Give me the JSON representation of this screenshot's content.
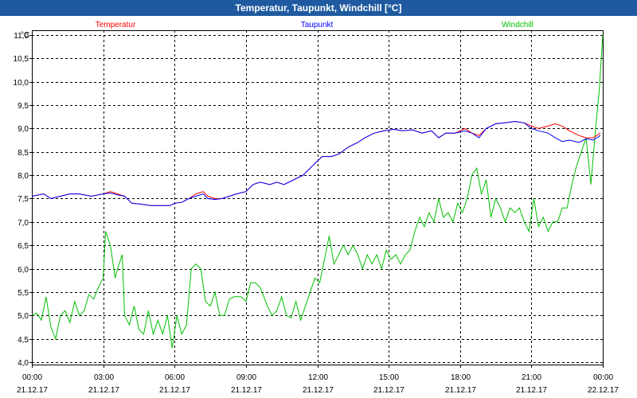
{
  "window": {
    "title": "Temperatur, Taupunkt, Windchill [°C]"
  },
  "colors": {
    "titlebar": "#1f5aa0",
    "temperatur": "#ff0000",
    "taupunkt": "#0000ff",
    "windchill": "#00c000",
    "grid": "#000000"
  },
  "chart_data": {
    "type": "line",
    "title": "Temperatur, Taupunkt, Windchill [°C]",
    "ylabel": "°C",
    "ylim": [
      3.95,
      11.1
    ],
    "yticks": [
      "4,0",
      "4,5",
      "5,0",
      "5,5",
      "6,0",
      "6,5",
      "7,0",
      "7,5",
      "8,0",
      "8,5",
      "9,0",
      "9,5",
      "10,0",
      "10,5",
      "11,0"
    ],
    "ytick_values": [
      4.0,
      4.5,
      5.0,
      5.5,
      6.0,
      6.5,
      7.0,
      7.5,
      8.0,
      8.5,
      9.0,
      9.5,
      10.0,
      10.5,
      11.0
    ],
    "xlim": [
      0,
      24
    ],
    "xticks": [
      {
        "time": "00:00",
        "date": "21.12.17",
        "hour": 0
      },
      {
        "time": "03:00",
        "date": "21.12.17",
        "hour": 3
      },
      {
        "time": "06:00",
        "date": "21.12.17",
        "hour": 6
      },
      {
        "time": "09:00",
        "date": "21.12.17",
        "hour": 9
      },
      {
        "time": "12:00",
        "date": "21.12.17",
        "hour": 12
      },
      {
        "time": "15:00",
        "date": "21.12.17",
        "hour": 15
      },
      {
        "time": "18:00",
        "date": "21.12.17",
        "hour": 18
      },
      {
        "time": "21:00",
        "date": "21.12.17",
        "hour": 21
      },
      {
        "time": "00:00",
        "date": "22.12.17",
        "hour": 24
      }
    ],
    "grid": true,
    "legend_placement": "top",
    "series": [
      {
        "name": "Temperatur",
        "color": "#ff0000",
        "points": [
          [
            0,
            7.55
          ],
          [
            0.5,
            7.6
          ],
          [
            0.8,
            7.5
          ],
          [
            1.2,
            7.55
          ],
          [
            1.6,
            7.6
          ],
          [
            2.0,
            7.6
          ],
          [
            2.5,
            7.55
          ],
          [
            3.0,
            7.6
          ],
          [
            3.3,
            7.65
          ],
          [
            3.6,
            7.6
          ],
          [
            3.9,
            7.55
          ],
          [
            4.2,
            7.4
          ],
          [
            4.6,
            7.38
          ],
          [
            5.0,
            7.35
          ],
          [
            5.4,
            7.35
          ],
          [
            5.8,
            7.35
          ],
          [
            6.0,
            7.4
          ],
          [
            6.3,
            7.42
          ],
          [
            6.6,
            7.5
          ],
          [
            6.9,
            7.6
          ],
          [
            7.2,
            7.65
          ],
          [
            7.4,
            7.55
          ],
          [
            7.7,
            7.5
          ],
          [
            8.0,
            7.5
          ],
          [
            8.3,
            7.55
          ],
          [
            8.6,
            7.6
          ],
          [
            9.0,
            7.65
          ],
          [
            9.3,
            7.8
          ],
          [
            9.6,
            7.85
          ],
          [
            10.0,
            7.8
          ],
          [
            10.3,
            7.85
          ],
          [
            10.6,
            7.8
          ],
          [
            11.0,
            7.9
          ],
          [
            11.4,
            8.0
          ],
          [
            11.8,
            8.2
          ],
          [
            12.2,
            8.4
          ],
          [
            12.6,
            8.4
          ],
          [
            12.9,
            8.45
          ],
          [
            13.3,
            8.6
          ],
          [
            13.7,
            8.7
          ],
          [
            14.0,
            8.8
          ],
          [
            14.4,
            8.9
          ],
          [
            14.8,
            8.95
          ],
          [
            15.2,
            8.98
          ],
          [
            15.6,
            8.95
          ],
          [
            16.0,
            8.97
          ],
          [
            16.4,
            8.9
          ],
          [
            16.8,
            8.95
          ],
          [
            17.1,
            8.8
          ],
          [
            17.4,
            8.9
          ],
          [
            17.8,
            8.9
          ],
          [
            18.2,
            9.0
          ],
          [
            18.5,
            8.9
          ],
          [
            18.8,
            8.85
          ],
          [
            19.1,
            9.0
          ],
          [
            19.5,
            9.1
          ],
          [
            19.9,
            9.12
          ],
          [
            20.3,
            9.15
          ],
          [
            20.7,
            9.12
          ],
          [
            21.0,
            9.05
          ],
          [
            21.3,
            9.0
          ],
          [
            21.7,
            9.05
          ],
          [
            22.0,
            9.1
          ],
          [
            22.3,
            9.05
          ],
          [
            22.6,
            8.95
          ],
          [
            23.0,
            8.85
          ],
          [
            23.3,
            8.8
          ],
          [
            23.6,
            8.8
          ],
          [
            23.9,
            8.9
          ]
        ]
      },
      {
        "name": "Taupunkt",
        "color": "#0000ff",
        "points": [
          [
            0,
            7.55
          ],
          [
            0.5,
            7.6
          ],
          [
            0.8,
            7.5
          ],
          [
            1.2,
            7.55
          ],
          [
            1.6,
            7.6
          ],
          [
            2.0,
            7.6
          ],
          [
            2.5,
            7.55
          ],
          [
            3.0,
            7.6
          ],
          [
            3.3,
            7.62
          ],
          [
            3.6,
            7.58
          ],
          [
            3.9,
            7.55
          ],
          [
            4.2,
            7.4
          ],
          [
            4.6,
            7.38
          ],
          [
            5.0,
            7.35
          ],
          [
            5.4,
            7.35
          ],
          [
            5.8,
            7.35
          ],
          [
            6.0,
            7.4
          ],
          [
            6.3,
            7.42
          ],
          [
            6.6,
            7.5
          ],
          [
            6.9,
            7.55
          ],
          [
            7.2,
            7.6
          ],
          [
            7.4,
            7.5
          ],
          [
            7.7,
            7.48
          ],
          [
            8.0,
            7.5
          ],
          [
            8.3,
            7.55
          ],
          [
            8.6,
            7.6
          ],
          [
            9.0,
            7.65
          ],
          [
            9.3,
            7.8
          ],
          [
            9.6,
            7.85
          ],
          [
            10.0,
            7.8
          ],
          [
            10.3,
            7.85
          ],
          [
            10.6,
            7.8
          ],
          [
            11.0,
            7.9
          ],
          [
            11.4,
            8.0
          ],
          [
            11.8,
            8.2
          ],
          [
            12.2,
            8.4
          ],
          [
            12.6,
            8.4
          ],
          [
            12.9,
            8.45
          ],
          [
            13.3,
            8.6
          ],
          [
            13.7,
            8.7
          ],
          [
            14.0,
            8.8
          ],
          [
            14.4,
            8.9
          ],
          [
            14.8,
            8.95
          ],
          [
            15.2,
            8.98
          ],
          [
            15.6,
            8.95
          ],
          [
            16.0,
            8.97
          ],
          [
            16.4,
            8.9
          ],
          [
            16.8,
            8.95
          ],
          [
            17.1,
            8.8
          ],
          [
            17.4,
            8.9
          ],
          [
            17.8,
            8.9
          ],
          [
            18.2,
            8.95
          ],
          [
            18.5,
            8.9
          ],
          [
            18.8,
            8.8
          ],
          [
            19.1,
            9.0
          ],
          [
            19.5,
            9.1
          ],
          [
            19.9,
            9.12
          ],
          [
            20.3,
            9.15
          ],
          [
            20.7,
            9.12
          ],
          [
            21.0,
            9.0
          ],
          [
            21.3,
            8.95
          ],
          [
            21.7,
            8.9
          ],
          [
            22.0,
            8.8
          ],
          [
            22.3,
            8.72
          ],
          [
            22.6,
            8.75
          ],
          [
            23.0,
            8.7
          ],
          [
            23.3,
            8.78
          ],
          [
            23.6,
            8.75
          ],
          [
            23.9,
            8.85
          ]
        ]
      },
      {
        "name": "Windchill",
        "color": "#00c000",
        "points": [
          [
            0,
            5.0
          ],
          [
            0.2,
            5.05
          ],
          [
            0.4,
            4.9
          ],
          [
            0.6,
            5.4
          ],
          [
            0.8,
            4.75
          ],
          [
            1.0,
            4.5
          ],
          [
            1.2,
            5.0
          ],
          [
            1.4,
            5.1
          ],
          [
            1.6,
            4.85
          ],
          [
            1.8,
            5.3
          ],
          [
            2.0,
            5.0
          ],
          [
            2.2,
            5.1
          ],
          [
            2.4,
            5.45
          ],
          [
            2.6,
            5.35
          ],
          [
            2.8,
            5.6
          ],
          [
            3.0,
            5.8
          ],
          [
            3.1,
            6.8
          ],
          [
            3.3,
            6.5
          ],
          [
            3.5,
            5.8
          ],
          [
            3.6,
            6.0
          ],
          [
            3.8,
            6.3
          ],
          [
            3.9,
            5.0
          ],
          [
            4.1,
            4.8
          ],
          [
            4.3,
            5.2
          ],
          [
            4.5,
            4.7
          ],
          [
            4.7,
            4.6
          ],
          [
            4.9,
            5.1
          ],
          [
            5.1,
            4.6
          ],
          [
            5.3,
            4.9
          ],
          [
            5.5,
            4.6
          ],
          [
            5.7,
            5.0
          ],
          [
            5.9,
            4.3
          ],
          [
            6.1,
            5.0
          ],
          [
            6.3,
            4.6
          ],
          [
            6.5,
            4.8
          ],
          [
            6.7,
            6.0
          ],
          [
            6.9,
            6.1
          ],
          [
            7.1,
            6.0
          ],
          [
            7.3,
            5.3
          ],
          [
            7.5,
            5.2
          ],
          [
            7.7,
            5.5
          ],
          [
            7.9,
            5.0
          ],
          [
            8.1,
            5.0
          ],
          [
            8.3,
            5.35
          ],
          [
            8.5,
            5.4
          ],
          [
            8.8,
            5.4
          ],
          [
            9.0,
            5.3
          ],
          [
            9.2,
            5.7
          ],
          [
            9.4,
            5.7
          ],
          [
            9.6,
            5.6
          ],
          [
            9.9,
            5.2
          ],
          [
            10.1,
            5.0
          ],
          [
            10.3,
            5.1
          ],
          [
            10.5,
            5.4
          ],
          [
            10.7,
            5.0
          ],
          [
            10.9,
            4.95
          ],
          [
            11.1,
            5.3
          ],
          [
            11.3,
            4.9
          ],
          [
            11.5,
            5.2
          ],
          [
            11.7,
            5.5
          ],
          [
            11.9,
            5.8
          ],
          [
            12.1,
            5.7
          ],
          [
            12.3,
            6.2
          ],
          [
            12.5,
            6.7
          ],
          [
            12.7,
            6.1
          ],
          [
            12.9,
            6.3
          ],
          [
            13.1,
            6.5
          ],
          [
            13.3,
            6.3
          ],
          [
            13.5,
            6.5
          ],
          [
            13.7,
            6.3
          ],
          [
            13.9,
            6.0
          ],
          [
            14.1,
            6.3
          ],
          [
            14.3,
            6.1
          ],
          [
            14.5,
            6.3
          ],
          [
            14.7,
            6.0
          ],
          [
            14.9,
            6.4
          ],
          [
            15.1,
            6.2
          ],
          [
            15.3,
            6.3
          ],
          [
            15.5,
            6.1
          ],
          [
            15.7,
            6.3
          ],
          [
            15.9,
            6.4
          ],
          [
            16.1,
            6.8
          ],
          [
            16.3,
            7.1
          ],
          [
            16.5,
            6.9
          ],
          [
            16.7,
            7.2
          ],
          [
            16.9,
            7.0
          ],
          [
            17.1,
            7.5
          ],
          [
            17.3,
            7.1
          ],
          [
            17.5,
            7.2
          ],
          [
            17.7,
            7.0
          ],
          [
            17.9,
            7.4
          ],
          [
            18.1,
            7.2
          ],
          [
            18.3,
            7.5
          ],
          [
            18.5,
            8.0
          ],
          [
            18.7,
            8.15
          ],
          [
            18.9,
            7.6
          ],
          [
            19.1,
            7.9
          ],
          [
            19.3,
            7.1
          ],
          [
            19.5,
            7.5
          ],
          [
            19.7,
            7.3
          ],
          [
            19.9,
            7.0
          ],
          [
            20.1,
            7.3
          ],
          [
            20.3,
            7.2
          ],
          [
            20.5,
            7.3
          ],
          [
            20.7,
            7.0
          ],
          [
            20.9,
            6.8
          ],
          [
            21.1,
            7.5
          ],
          [
            21.3,
            6.9
          ],
          [
            21.5,
            7.1
          ],
          [
            21.7,
            6.8
          ],
          [
            21.9,
            7.0
          ],
          [
            22.1,
            7.0
          ],
          [
            22.3,
            7.3
          ],
          [
            22.5,
            7.3
          ],
          [
            22.7,
            7.8
          ],
          [
            22.9,
            8.2
          ],
          [
            23.1,
            8.5
          ],
          [
            23.3,
            8.8
          ],
          [
            23.5,
            7.8
          ],
          [
            23.7,
            9.0
          ],
          [
            23.85,
            9.8
          ],
          [
            24.0,
            11.0
          ]
        ]
      }
    ]
  }
}
